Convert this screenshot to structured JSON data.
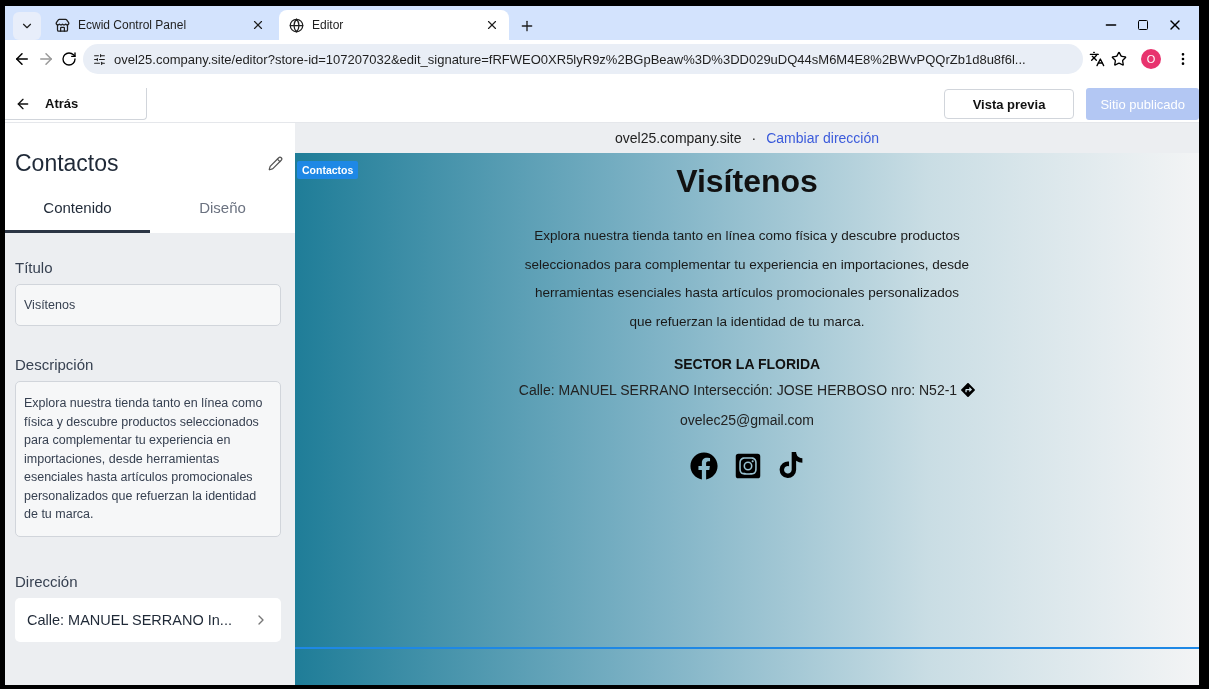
{
  "browser": {
    "tabs": [
      {
        "title": "Ecwid Control Panel",
        "selected": false,
        "kind": "store"
      },
      {
        "title": "Editor",
        "selected": true,
        "kind": "globe"
      }
    ],
    "url": "ovel25.company.site/editor?store-id=107207032&edit_signature=fRFWEO0XR5lyR9z%2BGpBeaw%3D%3DD029uDQ44sM6M4E8%2BWvPQQrZb1d8u8f6l...",
    "profile": "O"
  },
  "toolbar": {
    "back": "Atrás",
    "preview": "Vista previa",
    "publish": {
      "label": "Sitio publicado",
      "disabled": true
    }
  },
  "sidebar": {
    "title": "Contactos",
    "tabs": [
      {
        "label": "Contenido",
        "selected": true
      },
      {
        "label": "Diseño",
        "selected": false
      }
    ],
    "fields": [
      {
        "label": "Título",
        "kind": "input",
        "value": "Visítenos"
      },
      {
        "label": "Descripción",
        "kind": "textarea",
        "value": "Explora nuestra tienda tanto en línea como física y descubre productos seleccionados para complementar tu experiencia en importaciones, desde herramientas esenciales hasta artículos promocionales personalizados que refuerzan la identidad de tu marca."
      },
      {
        "label": "Dirección",
        "kind": "link",
        "value": "Calle: MANUEL SERRANO In..."
      }
    ]
  },
  "preview": {
    "domain": "ovel25.company.site",
    "separator": "·",
    "change_link": "Cambiar dirección",
    "section_badge": "Contactos",
    "heading": "Visítenos",
    "description": "Explora nuestra tienda tanto en línea como física y descubre productos seleccionados para complementar tu experiencia en importaciones, desde herramientas esenciales hasta artículos promocionales personalizados que refuerzan la identidad de tu marca.",
    "sector": "SECTOR LA FLORIDA",
    "address": "Calle: MANUEL SERRANO Intersección: JOSE HERBOSO nro: N52-1",
    "email": "ovelec25@gmail.com",
    "social": [
      {
        "kind": "facebook"
      },
      {
        "kind": "instagram"
      },
      {
        "kind": "tiktok"
      }
    ]
  }
}
